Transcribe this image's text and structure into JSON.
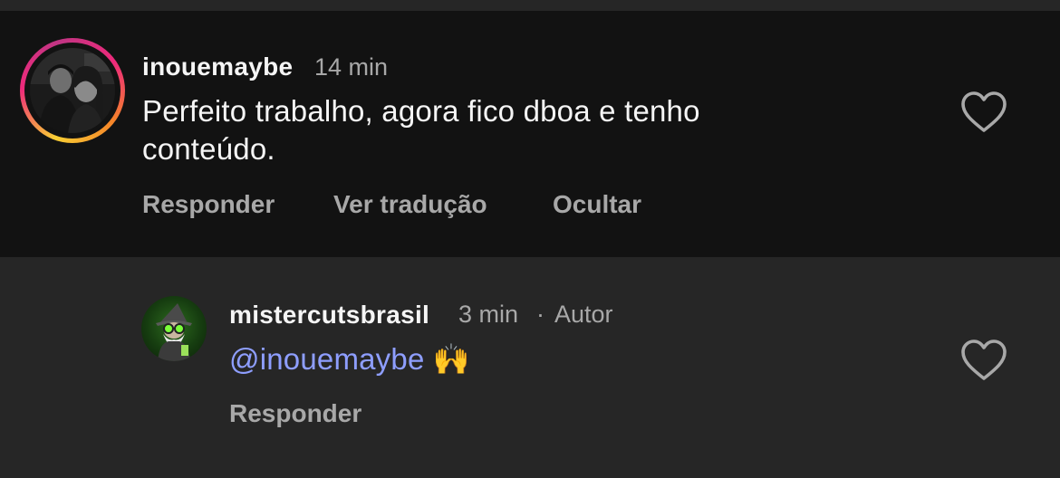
{
  "comments": [
    {
      "username": "inouemaybe",
      "time": "14 min",
      "text_line1": "Perfeito trabalho, agora fico dboa e tenho",
      "text_line2": "conteúdo.",
      "actions": {
        "reply": "Responder",
        "translate": "Ver tradução",
        "hide": "Ocultar"
      },
      "avatar_icon": "profile-photo",
      "like_icon": "heart-outline-icon"
    },
    {
      "username": "mistercutsbrasil",
      "time": "3 min",
      "separator": "·",
      "author_badge": "Autor",
      "mention": "@inouemaybe",
      "emoji": "🙌",
      "actions": {
        "reply": "Responder"
      },
      "avatar_icon": "wizard-logo",
      "like_icon": "heart-outline-icon"
    }
  ],
  "colors": {
    "main_background": "#121212",
    "reply_background": "#262626",
    "primary_text": "#f5f5f5",
    "secondary_text": "#a8a8a8",
    "mention": "#8e9eff"
  }
}
